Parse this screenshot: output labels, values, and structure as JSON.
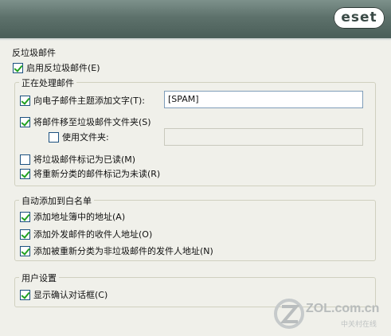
{
  "brand": {
    "logo_text": "eset"
  },
  "antispam": {
    "title": "反垃圾邮件",
    "enable_label": "启用反垃圾邮件(E)",
    "enable_checked": true
  },
  "processing": {
    "title": "正在处理邮件",
    "add_text_label": "向电子邮件主题添加文字(T):",
    "add_text_checked": true,
    "add_text_value": "[SPAM]",
    "move_label": "将邮件移至垃圾邮件文件夹(S)",
    "move_checked": true,
    "use_folder_label": "使用文件夹:",
    "use_folder_checked": false,
    "use_folder_value": "",
    "mark_read_label": "将垃圾邮件标记为已读(M)",
    "mark_read_checked": false,
    "mark_unread_label": "将重新分类的邮件标记为未读(R)",
    "mark_unread_checked": true
  },
  "whitelist": {
    "title": "自动添加到白名单",
    "address_book_label": "添加地址簿中的地址(A)",
    "address_book_checked": true,
    "outgoing_label": "添加外发邮件的收件人地址(O)",
    "outgoing_checked": true,
    "reclassified_label": "添加被重新分类为非垃圾邮件的发件人地址(N)",
    "reclassified_checked": true
  },
  "user_settings": {
    "title": "用户设置",
    "confirm_label": "显示确认对话框(C)",
    "confirm_checked": true
  },
  "watermark": {
    "site": "ZOL.com.cn",
    "tagline": "中关村在线"
  }
}
